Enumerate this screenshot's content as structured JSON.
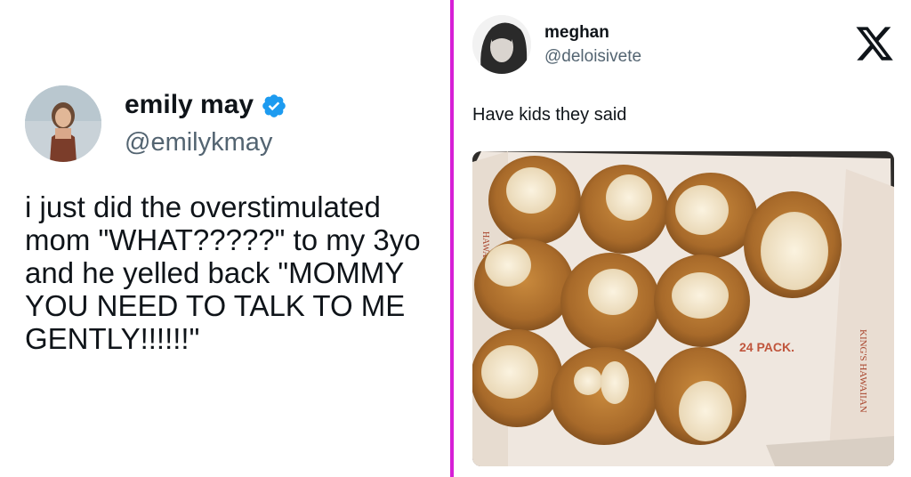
{
  "left_tweet": {
    "name": "emily may",
    "handle": "@emilykmay",
    "text": "i just did the overstimulated mom \"WHAT?????\" to my 3yo and he yelled back \"MOMMY YOU NEED TO TALK TO ME GENTLY!!!!!!\""
  },
  "right_tweet": {
    "name": "meghan",
    "handle": "@deloisivete",
    "text": "Have kids they said",
    "photo_box_text_1": "24 PACK.",
    "photo_box_text_2": "KING'S HAWAIIAN",
    "photo_box_text_3": "HAWAIIAN"
  },
  "colors": {
    "divider": "#d61fd6",
    "verified": "#1d9bf0",
    "handle": "#536471"
  },
  "icons": [
    "verified-badge-icon",
    "x-logo-icon"
  ]
}
